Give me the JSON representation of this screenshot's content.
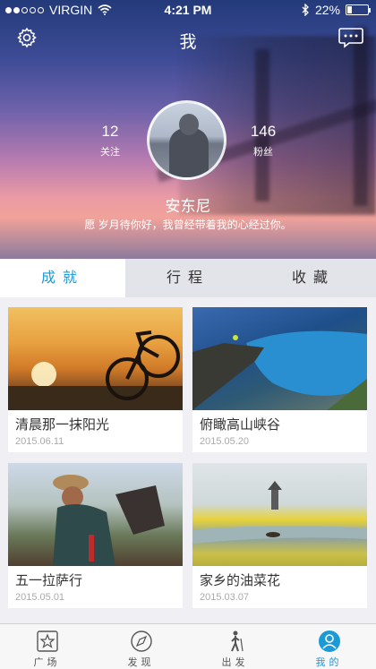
{
  "status": {
    "carrier": "VIRGIN",
    "time": "4:21 PM",
    "battery": "22%",
    "battery_level": 0.22
  },
  "nav": {
    "title": "我",
    "settings_icon": "gear-icon",
    "message_icon": "chat-bubble-icon"
  },
  "profile": {
    "following_count": "12",
    "following_label": "关注",
    "fans_count": "146",
    "fans_label": "粉丝",
    "name": "安东尼",
    "motto": "愿 岁月待你好，我曾经带着我的心经过你。"
  },
  "tabs": [
    {
      "label": "成就",
      "active": true
    },
    {
      "label": "行程",
      "active": false
    },
    {
      "label": "收藏",
      "active": false
    }
  ],
  "cards": [
    {
      "title": "清晨那一抹阳光",
      "date": "2015.06.11"
    },
    {
      "title": "俯瞰高山峡谷",
      "date": "2015.05.20"
    },
    {
      "title": "五一拉萨行",
      "date": "2015.05.01"
    },
    {
      "title": "家乡的油菜花",
      "date": "2015.03.07"
    }
  ],
  "tabbar": [
    {
      "label": "广场",
      "icon": "star-icon"
    },
    {
      "label": "发现",
      "icon": "compass-icon"
    },
    {
      "label": "出发",
      "icon": "hiker-icon"
    },
    {
      "label": "我的",
      "icon": "user-icon",
      "active": true
    }
  ],
  "colors": {
    "accent": "#1a9ad6"
  }
}
